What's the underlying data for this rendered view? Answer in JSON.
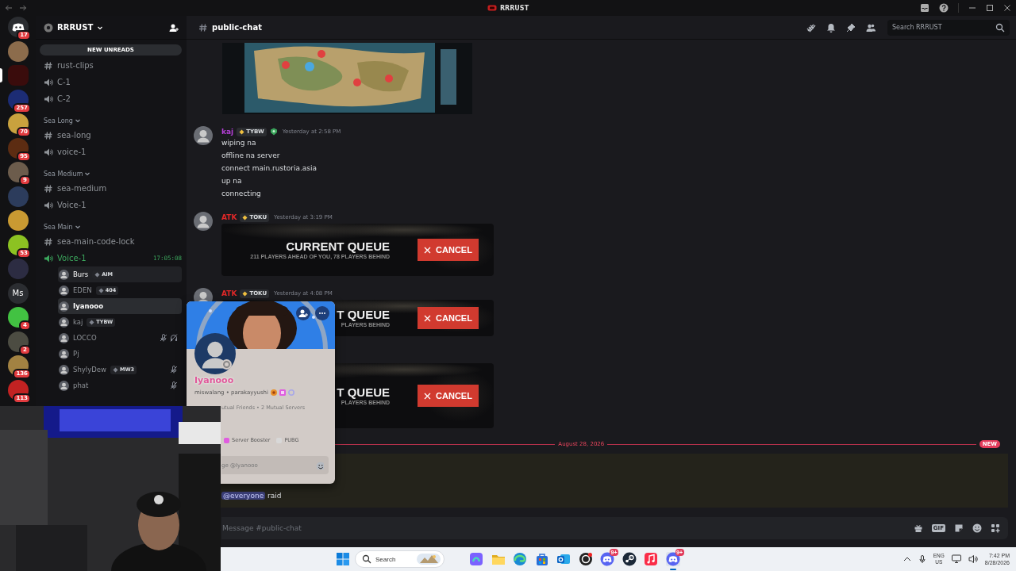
{
  "titlebar": {
    "title": "RRRUST"
  },
  "servers": [
    {
      "kind": "home",
      "selected": false,
      "badge": "17"
    },
    {
      "kind": "picture",
      "color": "#8c6c4c",
      "selected": false
    },
    {
      "kind": "picture",
      "color": "#3a0c0c",
      "selected": true
    },
    {
      "kind": "picture",
      "color": "#1c2c74",
      "selected": false,
      "badge": "257"
    },
    {
      "kind": "picture",
      "color": "#c9a23e",
      "selected": false,
      "badge": "70"
    },
    {
      "kind": "picture",
      "color": "#5c2c12",
      "selected": false,
      "badge": "95"
    },
    {
      "kind": "picture",
      "color": "#6c5c4c",
      "selected": false,
      "badge": "9"
    },
    {
      "kind": "picture",
      "color": "#2c3c5c",
      "selected": false
    },
    {
      "kind": "picture",
      "color": "#c99a32",
      "selected": false
    },
    {
      "kind": "picture",
      "color": "#8cc222",
      "selected": false,
      "badge": "53"
    },
    {
      "kind": "picture",
      "color": "#2c2c42",
      "selected": false
    },
    {
      "kind": "text",
      "label": "Ms",
      "color": "#2b2d31",
      "selected": false
    },
    {
      "kind": "picture",
      "color": "#42c242",
      "selected": false,
      "badge": "4"
    },
    {
      "kind": "picture",
      "color": "#4c4c42",
      "selected": false,
      "badge": "2"
    },
    {
      "kind": "picture",
      "color": "#a28242",
      "selected": false,
      "badge": "136"
    },
    {
      "kind": "picture",
      "color": "#c22222",
      "selected": false,
      "badge": "113"
    }
  ],
  "sidebar": {
    "server_name": "RRRUST",
    "new_unreads": "NEW UNREADS",
    "channels": [
      {
        "kind": "text",
        "name": "rust-clips"
      },
      {
        "kind": "voice",
        "name": "C-1",
        "connected": false
      },
      {
        "kind": "voice",
        "name": "C-2",
        "connected": false
      }
    ],
    "categories": [
      {
        "name": "Sea Long",
        "channels": [
          {
            "kind": "text",
            "name": "sea-long"
          },
          {
            "kind": "voice",
            "name": "voice-1",
            "connected": false
          }
        ]
      },
      {
        "name": "Sea Medium",
        "channels": [
          {
            "kind": "text",
            "name": "sea-medium"
          },
          {
            "kind": "voice",
            "name": "Voice-1",
            "connected": false
          }
        ]
      },
      {
        "name": "Sea Main",
        "channels": [
          {
            "kind": "text",
            "name": "sea-main-code-lock"
          },
          {
            "kind": "voice",
            "name": "Voice-1",
            "connected": true,
            "timer": "17:05:08",
            "children": [
              {
                "name": "Burs",
                "tag": "AIM",
                "selected": false,
                "hovered": true,
                "muted": false,
                "deafened": false
              },
              {
                "name": "EDEN",
                "tag": "404",
                "selected": false,
                "hovered": false,
                "muted": false,
                "deafened": false
              },
              {
                "name": "Iyanooo",
                "selected": true,
                "hovered": false,
                "muted": false,
                "deafened": false
              },
              {
                "name": "kaj",
                "tag": "TYBW",
                "selected": false,
                "hovered": false,
                "muted": false,
                "deafened": false
              },
              {
                "name": "LOCCO",
                "selected": false,
                "hovered": false,
                "muted": true,
                "deafened": true
              },
              {
                "name": "Pj",
                "selected": false,
                "hovered": false,
                "muted": false,
                "deafened": false
              },
              {
                "name": "ShylyDew",
                "tag": "MW3",
                "selected": false,
                "hovered": false,
                "muted": true,
                "deafened": false
              },
              {
                "name": "phat",
                "selected": false,
                "hovered": false,
                "muted": true,
                "deafened": false
              }
            ]
          }
        ]
      }
    ]
  },
  "chat": {
    "channel": "public-chat",
    "search_placeholder": "Search RRRUST",
    "messages": [
      {
        "kind": "attachment"
      },
      {
        "kind": "message",
        "author": "kaj",
        "color": "#b43fd6",
        "tag": "TYBW",
        "has_badge": true,
        "time": "Yesterday at 2:58 PM",
        "lines": [
          "wiping na",
          "offline na server",
          "connect main.rustoria.asia",
          "up na",
          "connecting"
        ]
      },
      {
        "kind": "message",
        "author": "ATK",
        "color": "#e02828",
        "tag": "TOKU",
        "time": "Yesterday at 3:19 PM",
        "embed": {
          "title": "CURRENT QUEUE",
          "subtitle": "211 PLAYERS AHEAD OF YOU, 78 PLAYERS BEHIND",
          "button": "CANCEL"
        }
      },
      {
        "kind": "message",
        "author": "ATK",
        "color": "#e02828",
        "tag": "TOKU",
        "time": "Yesterday at 4:08 PM",
        "embed": {
          "title": "T QUEUE",
          "subtitle": "PLAYERS BEHIND",
          "button": "CANCEL"
        }
      },
      {
        "kind": "embed",
        "embed": {
          "title": "T QUEUE",
          "subtitle": "PLAYERS BEHIND",
          "button": "CANCEL"
        }
      }
    ],
    "divider": {
      "date": "August 28, 2026",
      "badge": "NEW"
    },
    "mention_message": {
      "mention": "@everyone",
      "text": "raid"
    },
    "composer": {
      "placeholder": "Message #public-chat",
      "gif": "GIF"
    }
  },
  "profile_popup": {
    "name": "Iyanooo",
    "subtitle": "miswalang • parakayyushi",
    "mutual": "utual Friends • 2 Mutual Servers",
    "roles": [
      {
        "name": "Server Booster",
        "color": "#e05ce0"
      },
      {
        "name": "PUBG",
        "color": "#d8d8d8"
      }
    ],
    "message_placeholder": "ge @Iyanooo"
  },
  "taskbar": {
    "search": "Search",
    "apps": [
      {
        "kind": "copilot",
        "selected": false
      },
      {
        "kind": "files",
        "selected": false
      },
      {
        "kind": "edge",
        "selected": false
      },
      {
        "kind": "store",
        "selected": false
      },
      {
        "kind": "outlook",
        "selected": false
      },
      {
        "kind": "obs",
        "selected": false
      },
      {
        "kind": "discord",
        "badge": "9+",
        "selected": false
      },
      {
        "kind": "steam",
        "selected": false
      },
      {
        "kind": "music",
        "selected": false
      },
      {
        "kind": "discord",
        "badge": "9+",
        "selected": true
      }
    ],
    "lang": "ENG",
    "region": "US",
    "time": "7:42 PM",
    "date": "8/28/2026"
  }
}
